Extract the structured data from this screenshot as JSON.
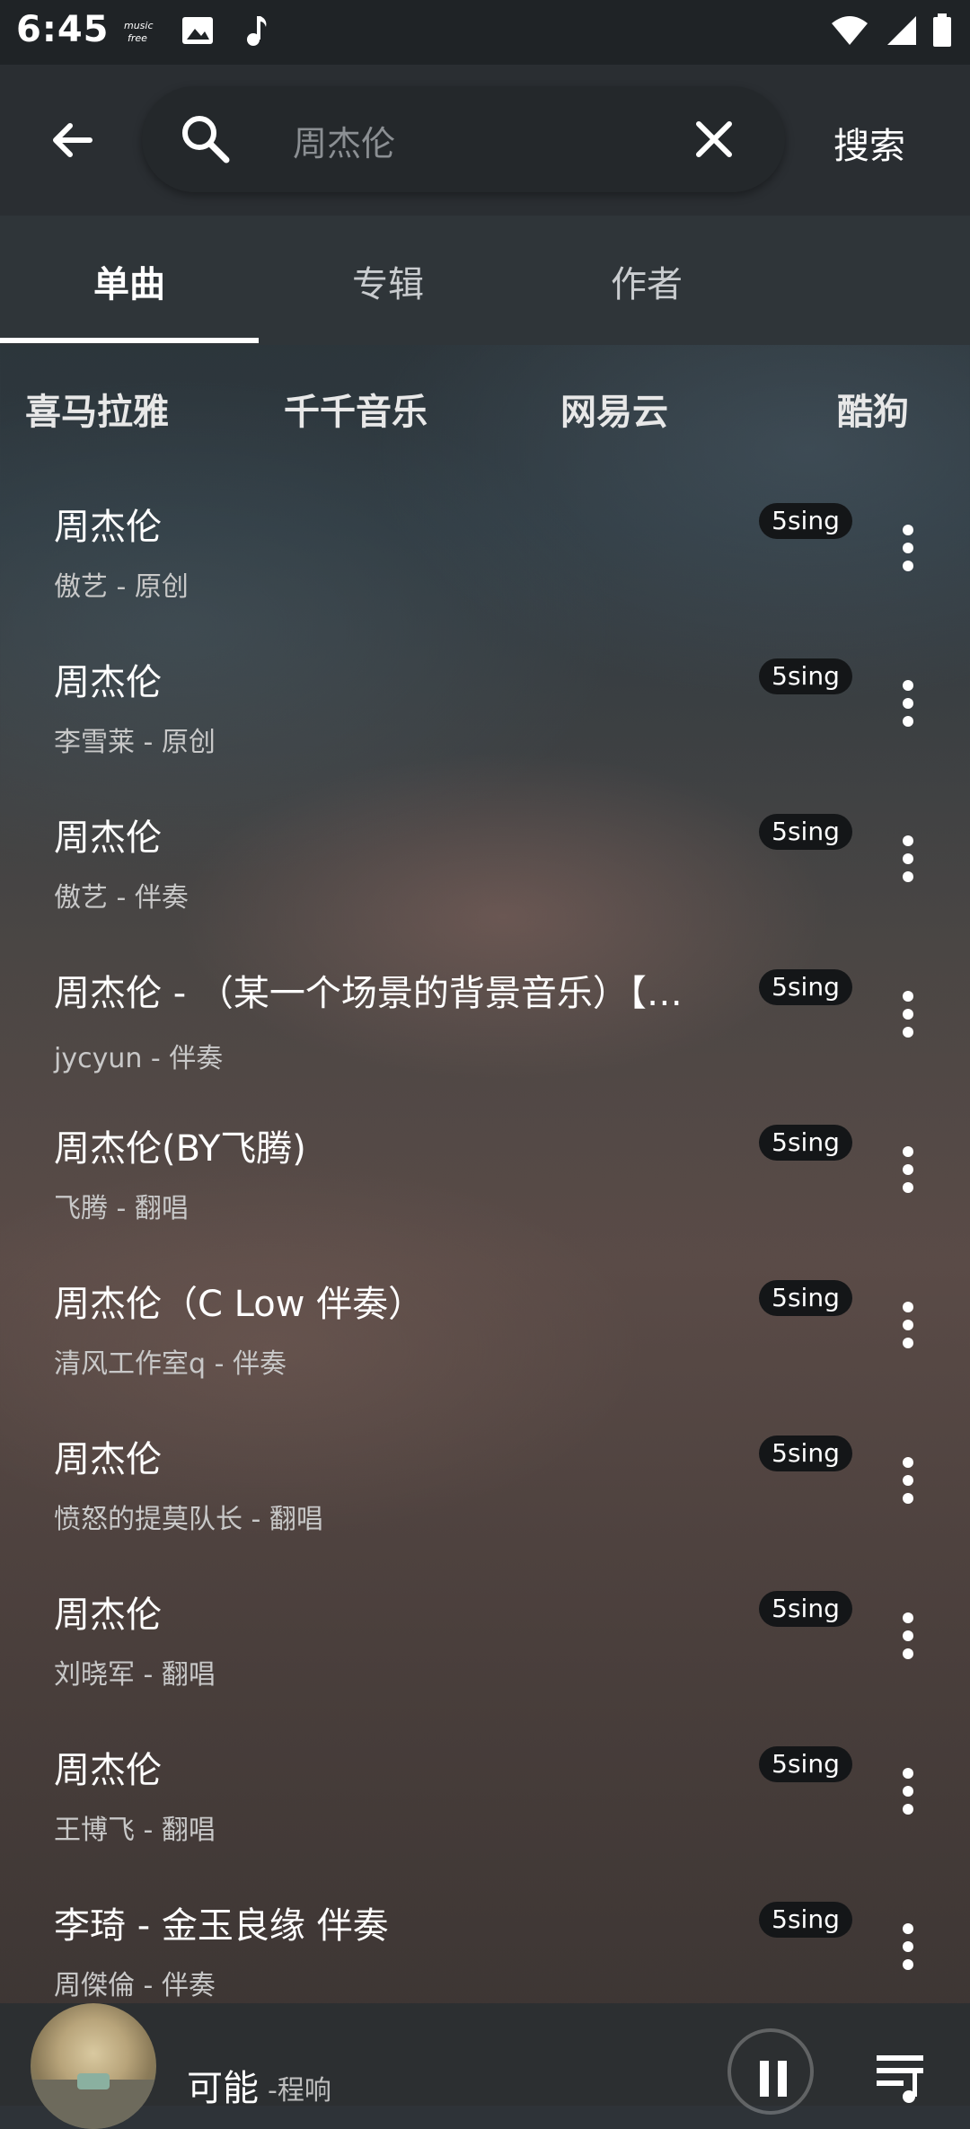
{
  "status": {
    "time": "6:45"
  },
  "header": {
    "search_value": "周杰伦",
    "search_button": "搜索"
  },
  "tabs": [
    {
      "label": "单曲",
      "active": true
    },
    {
      "label": "专辑",
      "active": false
    },
    {
      "label": "作者",
      "active": false
    }
  ],
  "sources": [
    "喜马拉雅",
    "千千音乐",
    "网易云",
    "酷狗"
  ],
  "results": [
    {
      "title": "周杰伦",
      "subtitle": "傲艺 - 原创",
      "badge": "5sing"
    },
    {
      "title": "周杰伦",
      "subtitle": "李雪莱 - 原创",
      "badge": "5sing"
    },
    {
      "title": "周杰伦",
      "subtitle": "傲艺 - 伴奏",
      "badge": "5sing"
    },
    {
      "title": "周杰伦 - （某一个场景的背景音乐）【…",
      "subtitle": "jycyun - 伴奏",
      "badge": "5sing"
    },
    {
      "title": "周杰伦(BY飞腾)",
      "subtitle": "飞腾 - 翻唱",
      "badge": "5sing"
    },
    {
      "title": "周杰伦（C Low 伴奏）",
      "subtitle": "清风工作室q - 伴奏",
      "badge": "5sing"
    },
    {
      "title": "周杰伦",
      "subtitle": "愤怒的提莫队长 - 翻唱",
      "badge": "5sing"
    },
    {
      "title": "周杰伦",
      "subtitle": "刘晓军 - 翻唱",
      "badge": "5sing"
    },
    {
      "title": "周杰伦",
      "subtitle": "王博飞 - 翻唱",
      "badge": "5sing"
    },
    {
      "title": "李琦 - 金玉良缘 伴奏",
      "subtitle": "周傑倫 - 伴奏",
      "badge": "5sing"
    }
  ],
  "player": {
    "song": "可能",
    "artist": "-程响"
  }
}
